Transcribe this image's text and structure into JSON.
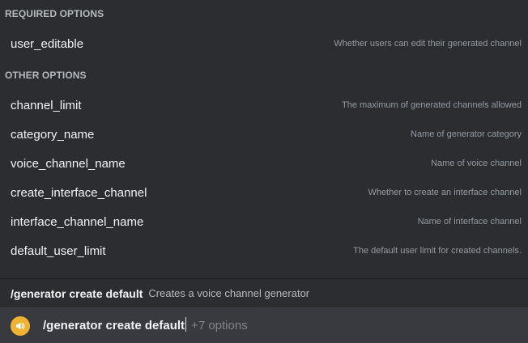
{
  "required_section": {
    "header": "REQUIRED OPTIONS",
    "options": [
      {
        "name": "user_editable",
        "description": "Whether users can edit their generated channel"
      }
    ]
  },
  "other_section": {
    "header": "OTHER OPTIONS",
    "options": [
      {
        "name": "channel_limit",
        "description": "The maximum of generated channels allowed"
      },
      {
        "name": "category_name",
        "description": "Name of generator category"
      },
      {
        "name": "voice_channel_name",
        "description": "Name of voice channel"
      },
      {
        "name": "create_interface_channel",
        "description": "Whether to create an interface channel"
      },
      {
        "name": "interface_channel_name",
        "description": "Name of interface channel"
      },
      {
        "name": "default_user_limit",
        "description": "The default user limit for created channels."
      }
    ]
  },
  "command": {
    "name": "/generator create default",
    "description": "Creates a voice channel generator"
  },
  "input": {
    "icon": "speaker-icon",
    "value": "/generator create default",
    "more_options": "+7 options"
  },
  "colors": {
    "background": "#2b2d31",
    "input_background": "#383a40",
    "icon_accent": "#f0b232"
  }
}
